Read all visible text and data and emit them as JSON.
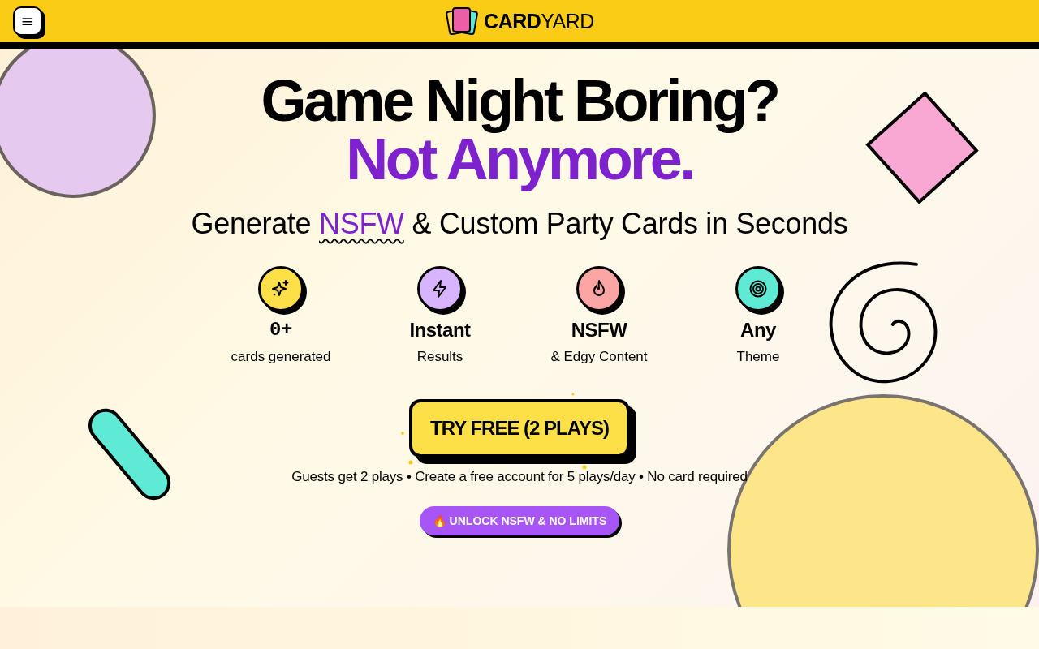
{
  "header": {
    "menu_button": "≡",
    "logo": "**CARD**YARD"
  },
  "hero": {
    "headline": "Game Night Boring?",
    "headline_accent": "Not Anymore.",
    "subtitle": {
      "before": "Generate",
      "highlight": "NSFW",
      "after": "& Custom Party Cards in Seconds"
    }
  },
  "stats": [
    {
      "kind": "sparkles",
      "color": "#fde047",
      "value": "0+",
      "label": "cards generated"
    },
    {
      "kind": "bolt",
      "color": "#d8b4fe",
      "value": "Instant",
      "label": "Results"
    },
    {
      "kind": "flame",
      "color": "#fca5a5",
      "value": "NSFW",
      "label": "& Edgy Content"
    },
    {
      "kind": "target",
      "color": "#5eead4",
      "value": "Any",
      "label": "Theme"
    }
  ],
  "cta": {
    "button": "TRY FREE (2 PLAYS)",
    "note": "Guests get 2 plays • Create a free account for 5 plays/day • No card required",
    "unlock_button": "🔥 UNLOCK NSFW & NO LIMITS"
  }
}
